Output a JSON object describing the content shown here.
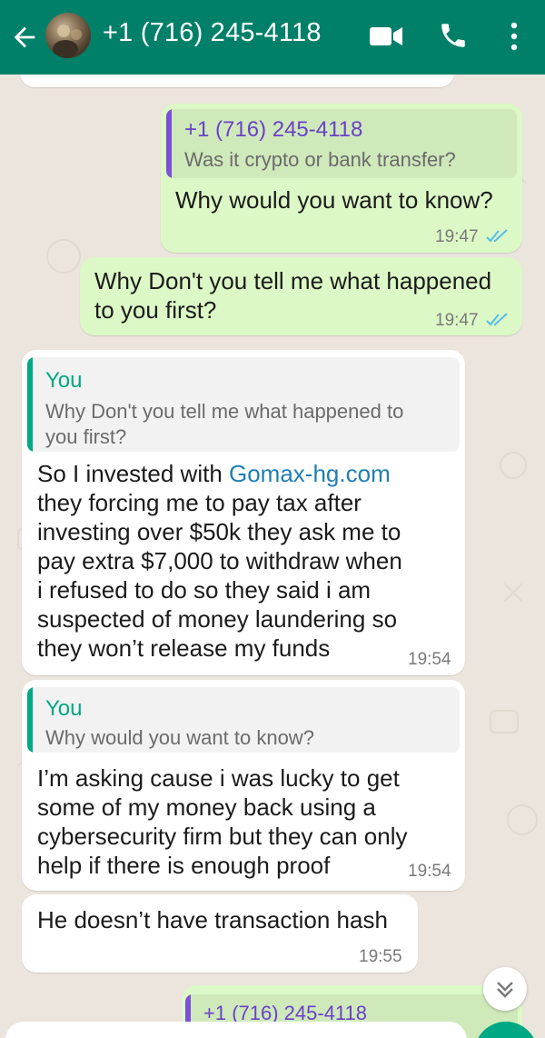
{
  "header": {
    "title": "+1 (716) 245-4118",
    "icons": [
      "back-arrow-icon",
      "avatar",
      "video-call-icon",
      "phone-call-icon",
      "more-vert-icon"
    ]
  },
  "messages": [
    {
      "direction": "out",
      "quote_name": "+1 (716) 245-4118",
      "quote_text": "Was it crypto or bank transfer?",
      "text": "Why would you want to know?",
      "time": "19:47",
      "status": "read"
    },
    {
      "direction": "out",
      "text_line1": "Why Don't you tell me what happened",
      "text_line2": "to you first?",
      "time": "19:47",
      "status": "read"
    },
    {
      "direction": "in",
      "quote_name": "You",
      "quote_line1": "Why Don't you tell me what happened to",
      "quote_line2": "you first?",
      "text_link": "Gomax-hg.com",
      "text_pre": "So I invested with ",
      "text_lines": [
        "they forcing me to pay tax after",
        "investing over $50k they ask me to",
        "pay extra $7,000 to withdraw when",
        "i refused to do so they said i am",
        "suspected of money laundering so",
        "they won’t release my funds"
      ],
      "time": "19:54"
    },
    {
      "direction": "in",
      "quote_name": "You",
      "quote_text": "Why would you want to know?",
      "text_lines": [
        "I’m asking cause i was lucky to get",
        "some of my money back using a",
        "cybersecurity firm but they can only",
        "help if there is enough proof"
      ],
      "time": "19:54"
    },
    {
      "direction": "in",
      "text": "He doesn’t have transaction hash",
      "time": "19:55"
    },
    {
      "direction": "out",
      "quote_name": "+1 (716) 245-4118"
    }
  ],
  "colors": {
    "header": "#008069",
    "outgoing_bubble": "#dcf8c6",
    "incoming_bubble": "#ffffff",
    "read_ticks": "#53bdeb",
    "quote_bar_out": "#7b4fd6",
    "quote_bar_in": "#00a884",
    "quote_name_in": "#00a884",
    "quote_name_out": "#6a41c9"
  }
}
